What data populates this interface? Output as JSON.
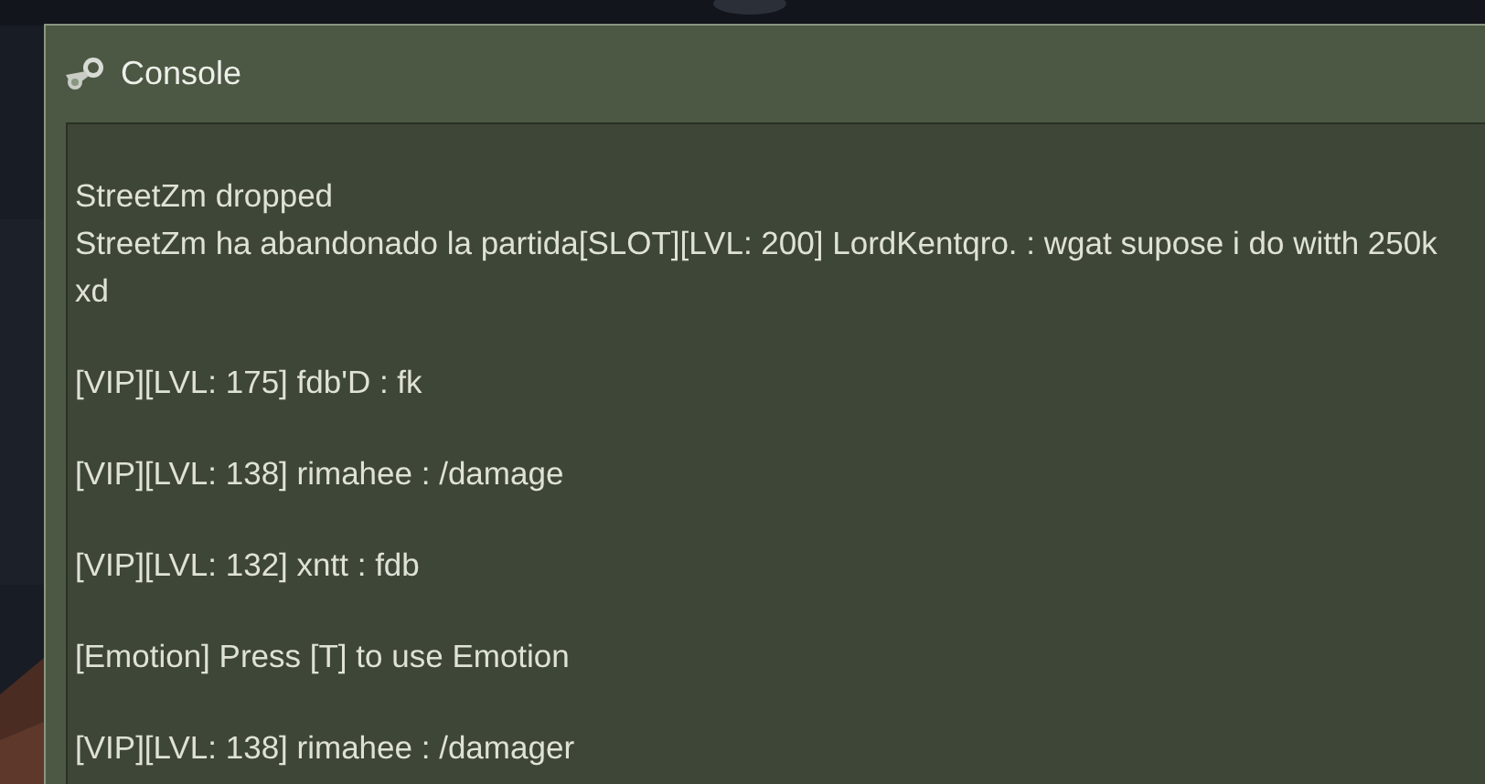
{
  "window": {
    "title": "Console"
  },
  "console": {
    "blocks": [
      [
        "StreetZm dropped",
        "StreetZm ha abandonado la partida[SLOT][LVL: 200] LordKentqro. : wgat supose i do witth 250k xd"
      ],
      [
        "[VIP][LVL: 175] fdb'D : fk"
      ],
      [
        "[VIP][LVL: 138] rimahee : /damage"
      ],
      [
        "[VIP][LVL: 132] xntt : fdb"
      ],
      [
        "[Emotion] Press [T] to use Emotion"
      ],
      [
        "[VIP][LVL: 138] rimahee : /damager"
      ]
    ]
  }
}
